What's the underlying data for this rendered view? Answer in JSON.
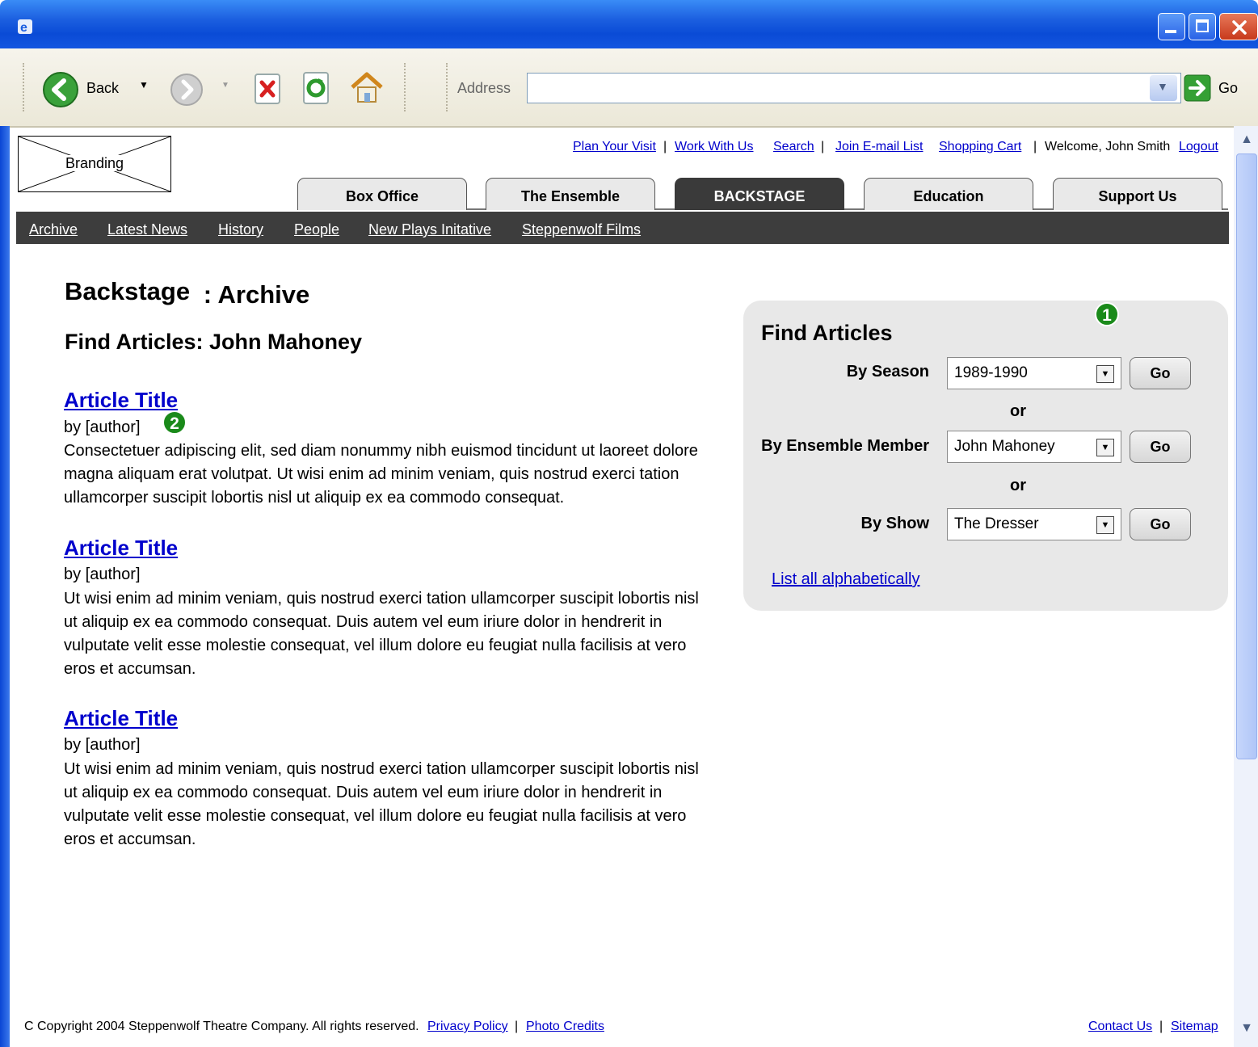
{
  "browser": {
    "toolbar": {
      "back_label": "Back",
      "address_label": "Address",
      "go_label": "Go",
      "address_value": ""
    }
  },
  "header": {
    "branding": "Branding",
    "utility_links": [
      "Plan Your Visit",
      "Work With Us",
      "Search",
      "Join E-mail List",
      "Shopping Cart"
    ],
    "welcome": "Welcome, John Smith",
    "logout": "Logout",
    "separator": "|"
  },
  "tabs": [
    "Box Office",
    "The Ensemble",
    "BACKSTAGE",
    "Education",
    "Support Us"
  ],
  "active_tab": "BACKSTAGE",
  "subnav": [
    "Archive",
    "Latest News",
    "History",
    "People",
    "New Plays Initative",
    "Steppenwolf Films"
  ],
  "main": {
    "title_section": "Backstage",
    "title_page": ": Archive",
    "subtitle": "Find Articles: John Mahoney",
    "articles": [
      {
        "title": "Article Title",
        "author": "by [author]",
        "body": "Consectetuer adipiscing elit, sed diam nonummy nibh euismod tincidunt ut laoreet dolore magna aliquam erat volutpat. Ut wisi enim ad minim veniam, quis nostrud exerci tation ullamcorper suscipit lobortis nisl ut aliquip ex ea commodo consequat."
      },
      {
        "title": "Article Title",
        "author": "by [author]",
        "body": "Ut wisi enim ad minim veniam, quis nostrud exerci tation ullamcorper suscipit lobortis nisl ut aliquip ex ea commodo consequat. Duis autem vel eum iriure dolor in hendrerit in vulputate velit esse molestie consequat, vel illum dolore eu feugiat nulla facilisis at vero eros et accumsan."
      },
      {
        "title": "Article Title",
        "author": "by [author]",
        "body": "Ut wisi enim ad minim veniam, quis nostrud exerci tation ullamcorper suscipit lobortis nisl ut aliquip ex ea commodo consequat. Duis autem vel eum iriure dolor in hendrerit in vulputate velit esse molestie consequat, vel illum dolore eu feugiat nulla facilisis at vero eros et accumsan."
      }
    ]
  },
  "find_panel": {
    "title": "Find Articles",
    "by_season_label": "By Season",
    "by_season_value": "1989-1990",
    "by_member_label": "By Ensemble Member",
    "by_member_value": "John Mahoney",
    "by_show_label": "By Show",
    "by_show_value": "The Dresser",
    "or_label": "or",
    "go_label": "Go",
    "list_all": "List all alphabetically"
  },
  "annotations": {
    "badge1": "1",
    "badge2": "2"
  },
  "footer": {
    "copyright": "C Copyright 2004 Steppenwolf Theatre Company. All rights reserved.",
    "privacy": "Privacy Policy",
    "photo_credits": "Photo Credits",
    "contact": "Contact Us",
    "sitemap": "Sitemap",
    "separator": "|"
  },
  "colors": {
    "link": "#0000cc",
    "subnav_bg": "#3d3d3d",
    "badge": "#1a8a1a",
    "panel_bg": "#e8e8e8"
  }
}
